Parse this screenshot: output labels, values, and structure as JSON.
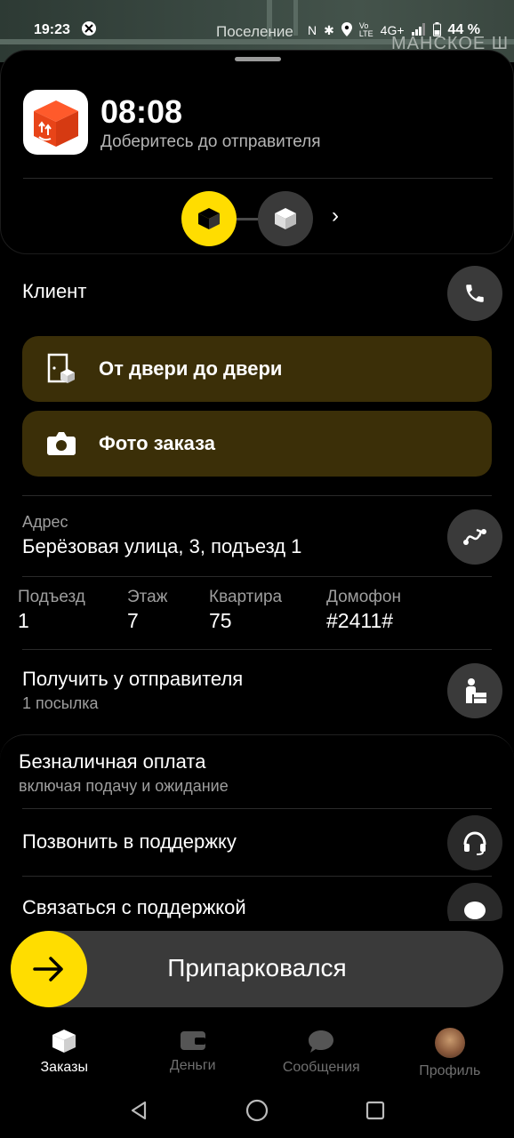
{
  "map": {
    "place_label": "Поселение",
    "place_label2": "МАНСКОЕ Ш"
  },
  "status_bar": {
    "time": "19:23",
    "battery": "44 %",
    "network": "4G+"
  },
  "order": {
    "eta": "08:08",
    "instruction": "Доберитесь до отправителя"
  },
  "client": {
    "label": "Клиент"
  },
  "actions": [
    {
      "label": "От двери до двери",
      "icon": "door-box-icon"
    },
    {
      "label": "Фото заказа",
      "icon": "camera-icon"
    }
  ],
  "address": {
    "caption": "Адрес",
    "value": "Берёзовая улица, 3, подъезд 1"
  },
  "details": [
    {
      "key": "Подъезд",
      "value": "1"
    },
    {
      "key": "Этаж",
      "value": "7"
    },
    {
      "key": "Квартира",
      "value": "75"
    },
    {
      "key": "Домофон",
      "value": "#2411#"
    }
  ],
  "pickup": {
    "title": "Получить у отправителя",
    "subtitle": "1 посылка"
  },
  "payment": {
    "title": "Безналичная оплата",
    "subtitle": "включая подачу и ожидание"
  },
  "support": {
    "call_label": "Позвонить в поддержку",
    "chat_label": "Связаться с поддержкой"
  },
  "slide_button": {
    "label": "Припарковался"
  },
  "bottom_nav": [
    {
      "label": "Заказы",
      "icon": "orders-icon",
      "active": true
    },
    {
      "label": "Деньги",
      "icon": "wallet-icon",
      "active": false
    },
    {
      "label": "Сообщения",
      "icon": "chat-icon",
      "active": false
    },
    {
      "label": "Профиль",
      "icon": "avatar",
      "active": false
    }
  ],
  "colors": {
    "accent": "#ffdd00",
    "action_bg": "#3b2f08",
    "panel": "#000000",
    "button": "#3a3a3a"
  }
}
